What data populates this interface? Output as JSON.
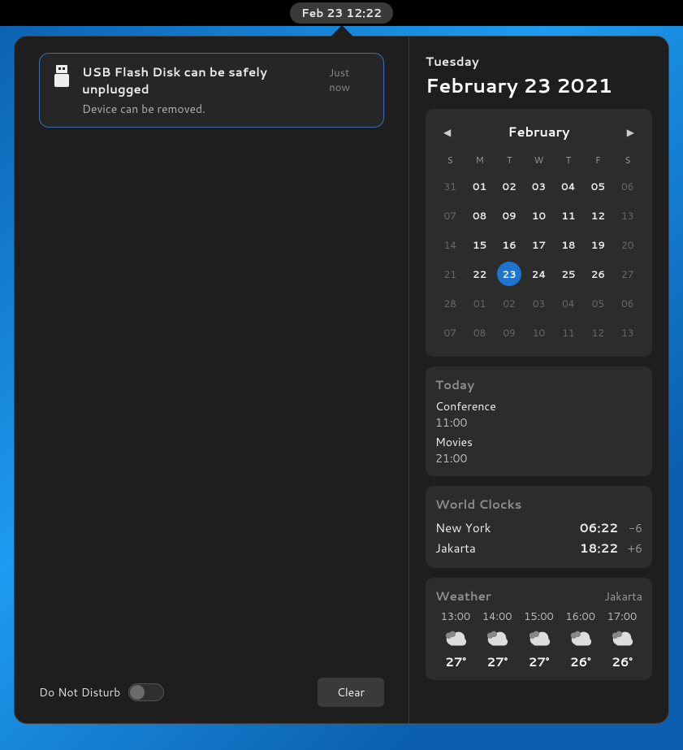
{
  "topbar": {
    "clock": "Feb 23  12:22"
  },
  "notification": {
    "title": "USB Flash Disk can be safely unplugged",
    "timestamp": "Just now",
    "body": "Device can be removed.",
    "icon": "usb-icon"
  },
  "dnd": {
    "label": "Do Not Disturb",
    "state": "off"
  },
  "clear_button": "Clear",
  "date_head": {
    "weekday": "Tuesday",
    "full": "February 23 2021"
  },
  "calendar": {
    "month_label": "February",
    "dow": [
      "S",
      "M",
      "T",
      "W",
      "T",
      "F",
      "S"
    ],
    "weeks": [
      [
        {
          "n": "31",
          "dim": true
        },
        {
          "n": "01"
        },
        {
          "n": "02"
        },
        {
          "n": "03"
        },
        {
          "n": "04"
        },
        {
          "n": "05"
        },
        {
          "n": "06",
          "dim": true
        }
      ],
      [
        {
          "n": "07",
          "dim": true
        },
        {
          "n": "08"
        },
        {
          "n": "09"
        },
        {
          "n": "10"
        },
        {
          "n": "11"
        },
        {
          "n": "12"
        },
        {
          "n": "13",
          "dim": true
        }
      ],
      [
        {
          "n": "14",
          "dim": true
        },
        {
          "n": "15"
        },
        {
          "n": "16"
        },
        {
          "n": "17"
        },
        {
          "n": "18"
        },
        {
          "n": "19"
        },
        {
          "n": "20",
          "dim": true
        }
      ],
      [
        {
          "n": "21",
          "dim": true
        },
        {
          "n": "22"
        },
        {
          "n": "23",
          "today": true
        },
        {
          "n": "24"
        },
        {
          "n": "25"
        },
        {
          "n": "26"
        },
        {
          "n": "27",
          "dim": true
        }
      ],
      [
        {
          "n": "28",
          "dim": true
        },
        {
          "n": "01",
          "dim": true
        },
        {
          "n": "02",
          "dim": true
        },
        {
          "n": "03",
          "dim": true
        },
        {
          "n": "04",
          "dim": true
        },
        {
          "n": "05",
          "dim": true
        },
        {
          "n": "06",
          "dim": true
        }
      ],
      [
        {
          "n": "07",
          "dim": true
        },
        {
          "n": "08",
          "dim": true
        },
        {
          "n": "09",
          "dim": true
        },
        {
          "n": "10",
          "dim": true
        },
        {
          "n": "11",
          "dim": true
        },
        {
          "n": "12",
          "dim": true
        },
        {
          "n": "13",
          "dim": true
        }
      ]
    ]
  },
  "today": {
    "heading": "Today",
    "events": [
      {
        "name": "Conference",
        "time": "11:00"
      },
      {
        "name": "Movies",
        "time": "21:00"
      }
    ]
  },
  "world_clocks": {
    "heading": "World Clocks",
    "rows": [
      {
        "city": "New York",
        "time": "06:22",
        "offset": "-6"
      },
      {
        "city": "Jakarta",
        "time": "18:22",
        "offset": "+6"
      }
    ]
  },
  "weather": {
    "heading": "Weather",
    "location": "Jakarta",
    "forecast": [
      {
        "time": "13:00",
        "icon": "cloudy",
        "temp": "27°"
      },
      {
        "time": "14:00",
        "icon": "cloudy",
        "temp": "27°"
      },
      {
        "time": "15:00",
        "icon": "cloudy",
        "temp": "27°"
      },
      {
        "time": "16:00",
        "icon": "cloudy",
        "temp": "26°"
      },
      {
        "time": "17:00",
        "icon": "cloudy",
        "temp": "26°"
      }
    ]
  }
}
